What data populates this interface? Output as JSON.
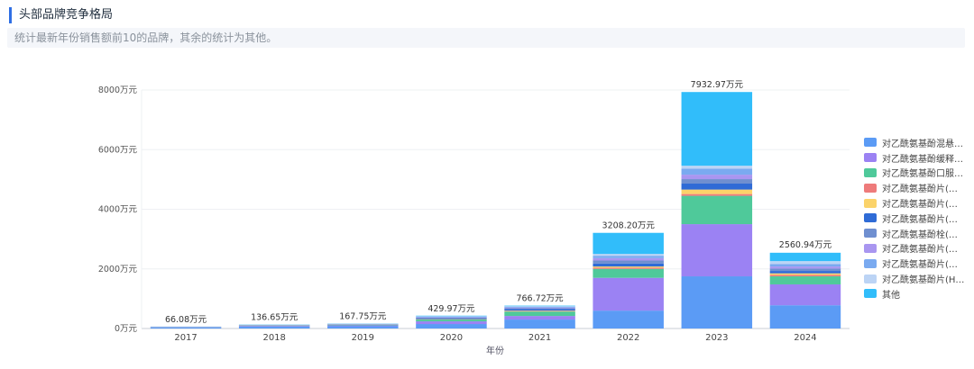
{
  "header": {
    "title": "头部品牌竞争格局",
    "description": "统计最新年份销售额前10的品牌，其余的统计为其他。"
  },
  "chart_data": {
    "type": "bar",
    "stacked": true,
    "categories": [
      "2017",
      "2018",
      "2019",
      "2020",
      "2021",
      "2022",
      "2023",
      "2024"
    ],
    "totals": [
      66.08,
      136.65,
      167.75,
      429.97,
      766.72,
      3208.2,
      7932.97,
      2560.94
    ],
    "total_labels": [
      "66.08万元",
      "136.65万元",
      "167.75万元",
      "429.97万元",
      "766.72万元",
      "3208.20万元",
      "7932.97万元",
      "2560.94万元"
    ],
    "xlabel": "年份",
    "ylim": [
      0,
      8000
    ],
    "y_ticks": [
      0,
      2000,
      4000,
      6000,
      8000
    ],
    "y_tick_labels": [
      "0万元",
      "2000万元",
      "4000万元",
      "6000万元",
      "8000万元"
    ],
    "legend_position": "right",
    "series": [
      {
        "name": "对乙酰氨基酚混悬滴剂...",
        "color": "#5b9bf5",
        "values": [
          40,
          60,
          75,
          150,
          300,
          600,
          1750,
          780
        ]
      },
      {
        "name": "对乙酰氨基酚缓释片(...",
        "color": "#9b82f3",
        "values": [
          10,
          25,
          30,
          90,
          120,
          1100,
          1750,
          700
        ]
      },
      {
        "name": "对乙酰氨基酚口服混悬...",
        "color": "#4fc99a",
        "values": [
          6,
          15,
          20,
          60,
          150,
          300,
          950,
          270
        ]
      },
      {
        "name": "对乙酰氨基酚片(山西...",
        "color": "#ee7b7b",
        "values": [
          1,
          2,
          3,
          8,
          15,
          40,
          60,
          50
        ]
      },
      {
        "name": "对乙酰氨基酚片(东北...",
        "color": "#fbd36a",
        "values": [
          1,
          2,
          3,
          8,
          15,
          40,
          150,
          50
        ]
      },
      {
        "name": "对乙酰氨基酚片(特一...",
        "color": "#2f6bd6",
        "values": [
          2,
          8,
          10,
          30,
          50,
          100,
          200,
          80
        ]
      },
      {
        "name": "对乙酰氨基酚栓(湖北...",
        "color": "#6f8fd0",
        "values": [
          1,
          5,
          5,
          20,
          30,
          100,
          150,
          80
        ]
      },
      {
        "name": "对乙酰氨基酚片(国药...",
        "color": "#a996f0",
        "values": [
          1,
          4,
          5,
          15,
          25,
          80,
          150,
          70
        ]
      },
      {
        "name": "对乙酰氨基酚片(天方...",
        "color": "#7aaaf0",
        "values": [
          1,
          5,
          5,
          20,
          25,
          80,
          200,
          80
        ]
      },
      {
        "name": "对乙酰氨基酚片(Ha...",
        "color": "#bcd4f5",
        "values": [
          1,
          5,
          5,
          10,
          16,
          60,
          100,
          100
        ]
      },
      {
        "name": "其他",
        "color": "#31bdfa",
        "values": [
          2.08,
          5.65,
          6.75,
          18.97,
          20.72,
          708.2,
          2472.97,
          280.94
        ]
      }
    ]
  }
}
